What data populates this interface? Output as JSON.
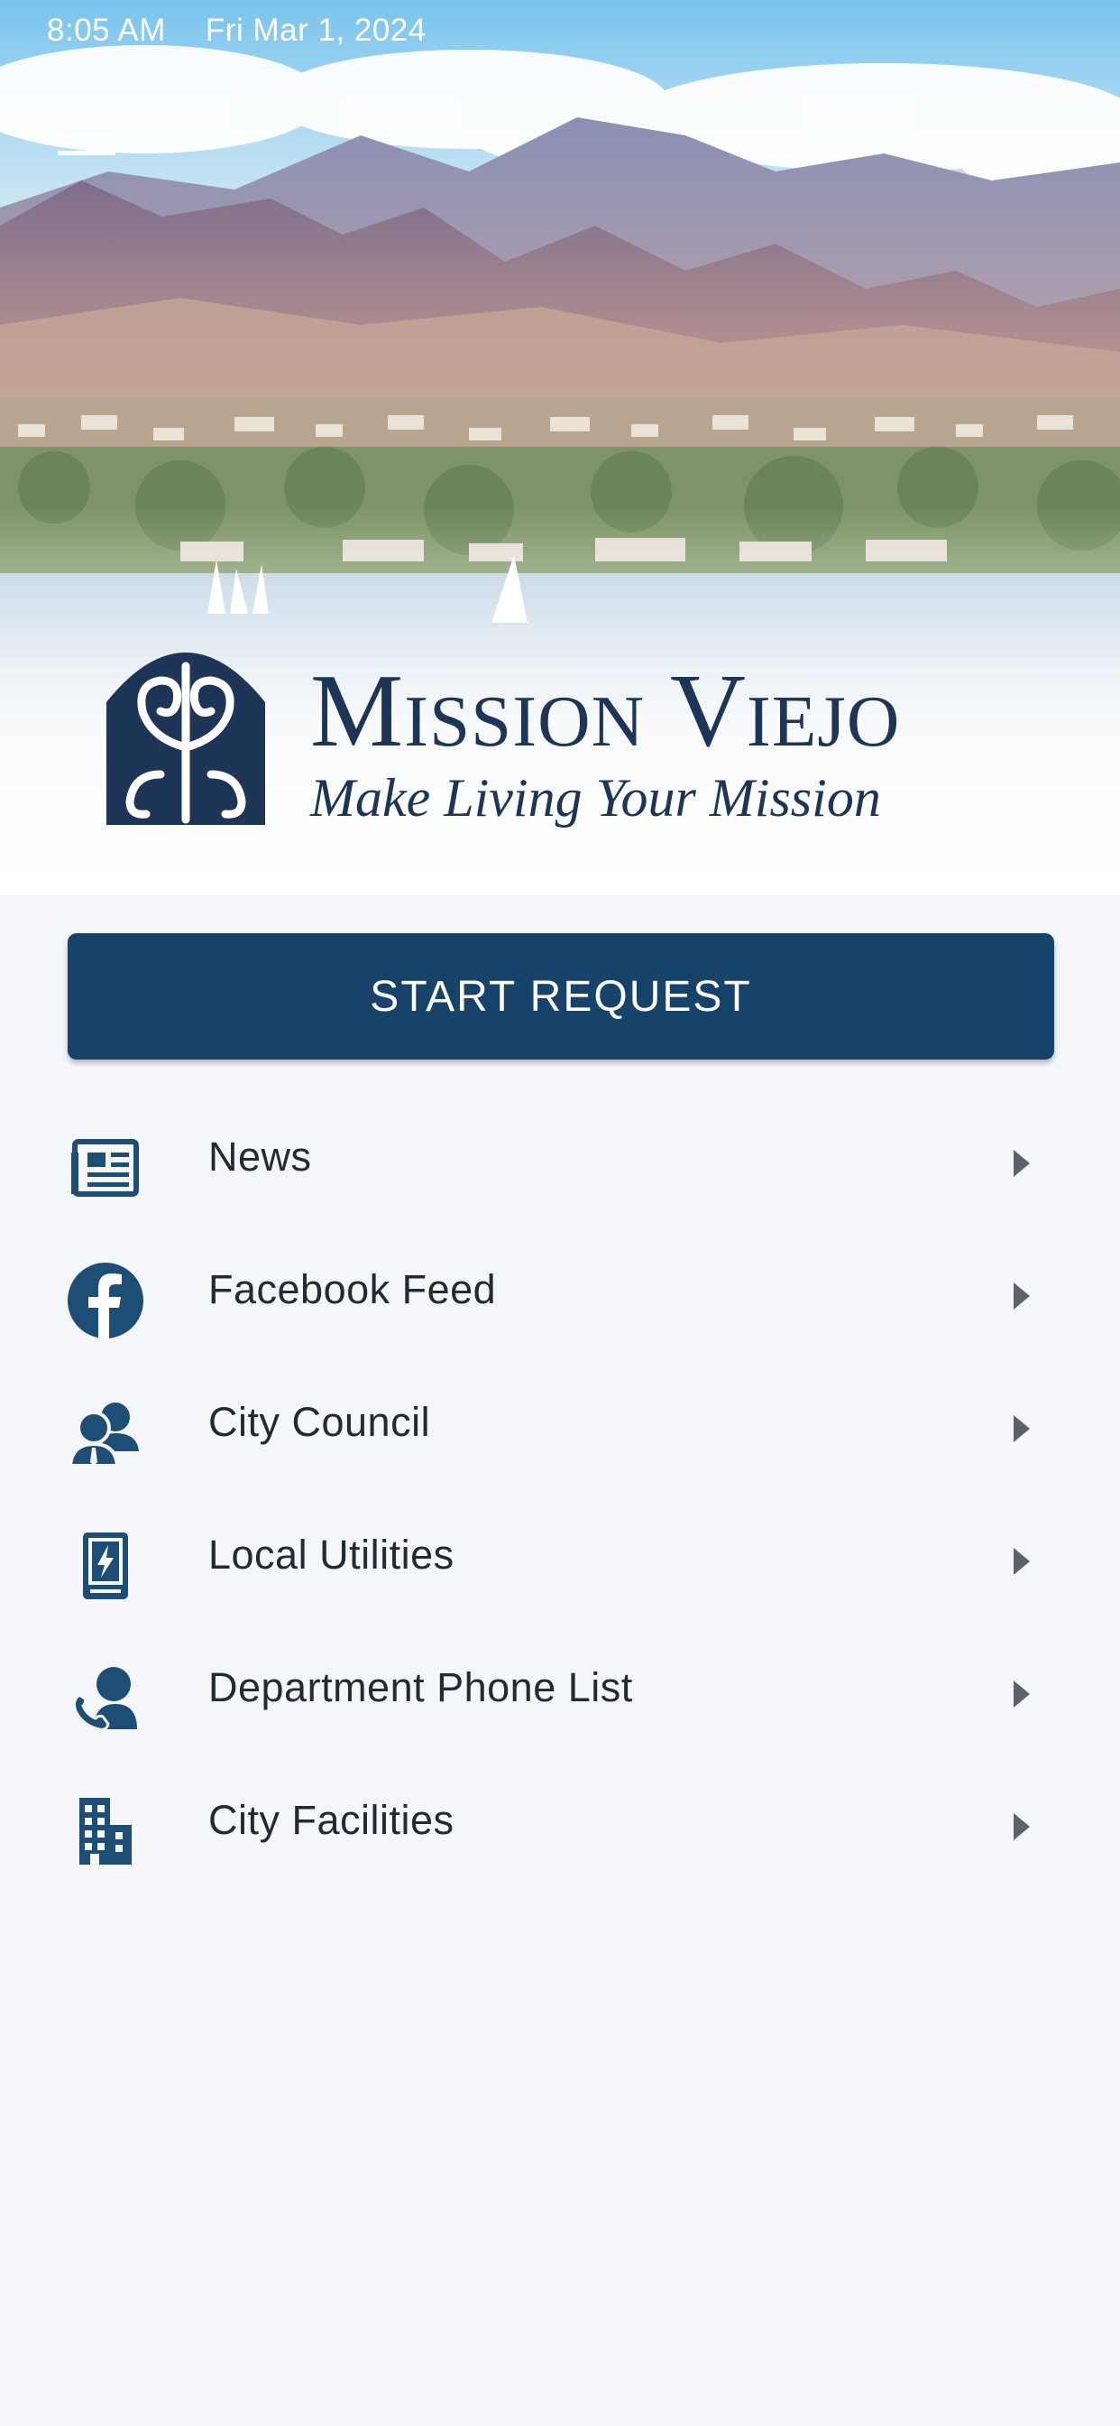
{
  "status_bar": {
    "time": "8:05 AM",
    "date": "Fri Mar 1, 2024"
  },
  "header": {
    "menu_icon": "hamburger-menu-icon",
    "logo": {
      "name": "Mission Viejo",
      "tagline": "Make Living Your Mission"
    }
  },
  "start_request": {
    "label": "START REQUEST"
  },
  "menu": {
    "items": [
      {
        "label": "News",
        "icon": "newspaper-icon"
      },
      {
        "label": "Facebook Feed",
        "icon": "facebook-icon"
      },
      {
        "label": "City Council",
        "icon": "people-icon"
      },
      {
        "label": "Local Utilities",
        "icon": "utility-bolt-icon"
      },
      {
        "label": "Department Phone List",
        "icon": "phone-contact-icon"
      },
      {
        "label": "City Facilities",
        "icon": "building-icon"
      }
    ]
  },
  "colors": {
    "primary": "#17426a",
    "logo": "#1d3557",
    "background": "#f4f6f9",
    "icon": "#1d4e75"
  }
}
